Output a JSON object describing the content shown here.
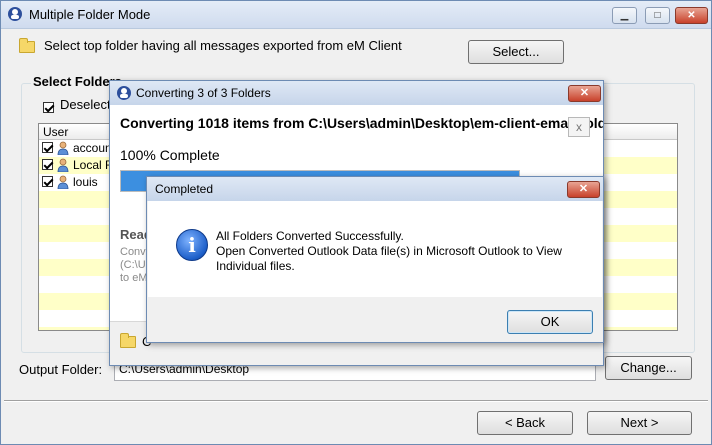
{
  "window": {
    "title": "Multiple Folder Mode",
    "minimize": "▁",
    "maximize": "□",
    "close": "✕"
  },
  "select_row": {
    "text": "Select top folder having all messages exported from eM Client",
    "button": "Select..."
  },
  "group": {
    "label": "Select Folders",
    "deselect_label": "Deselect All"
  },
  "list": {
    "header": "User",
    "rows": [
      {
        "name": "account",
        "checked": true
      },
      {
        "name": "Local Folders",
        "checked": true
      },
      {
        "name": "louis",
        "checked": true
      }
    ]
  },
  "output": {
    "label": "Output Folder:",
    "value": "C:\\Users\\admin\\Desktop",
    "change_button": "Change..."
  },
  "nav": {
    "back": "< Back",
    "next": "Next >"
  },
  "converting": {
    "title": "Converting 3 of 3 Folders",
    "heading": "Converting 1018 items from C:\\Users\\admin\\Desktop\\em-client-email-folder",
    "cancel": "x",
    "percent_text": "100% Complete",
    "progress": 1.0,
    "reading_label": "Reading",
    "path_lines": [
      "Converting",
      "(C:\\Users",
      "to eM Client"
    ],
    "footer_text": "C",
    "close": "✕"
  },
  "completed": {
    "title": "Completed",
    "lines": [
      "All Folders Converted Successfully.",
      "Open Converted Outlook Data file(s) in Microsoft Outlook to View",
      "Individual files."
    ],
    "ok": "OK",
    "close": "✕",
    "info_glyph": "i"
  },
  "colors": {
    "progress": "#3c8fe0",
    "row_alt": "#ffffc8",
    "close_red": "#c8412b"
  }
}
